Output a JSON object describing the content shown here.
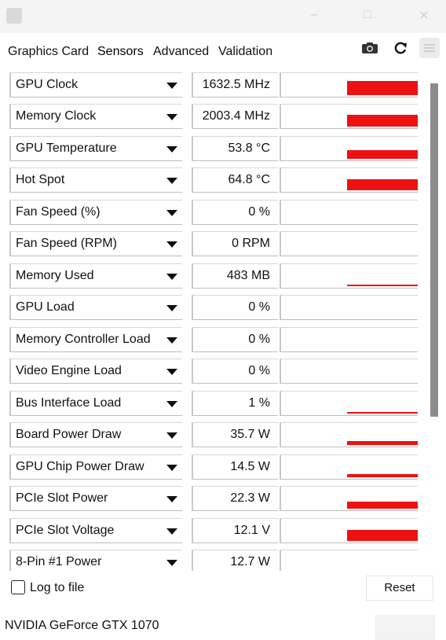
{
  "tabs": [
    {
      "label": "Graphics Card"
    },
    {
      "label": "Sensors",
      "active": true
    },
    {
      "label": "Advanced"
    },
    {
      "label": "Validation"
    }
  ],
  "icons": {
    "camera": "camera-icon",
    "refresh": "refresh-icon",
    "menu": "menu-icon"
  },
  "colors": {
    "graph_bar": "#ee1111",
    "scrollbar_thumb": "#8c8c8c"
  },
  "sensors": [
    {
      "name": "GPU Clock",
      "value": "1632.5 MHz",
      "graph_level": 0.6
    },
    {
      "name": "Memory Clock",
      "value": "2003.4 MHz",
      "graph_level": 0.5
    },
    {
      "name": "GPU Temperature",
      "value": "53.8 °C",
      "graph_level": 0.35
    },
    {
      "name": "Hot Spot",
      "value": "64.8 °C",
      "graph_level": 0.45
    },
    {
      "name": "Fan Speed (%)",
      "value": "0 %",
      "graph_level": 0
    },
    {
      "name": "Fan Speed (RPM)",
      "value": "0 RPM",
      "graph_level": 0
    },
    {
      "name": "Memory Used",
      "value": "483 MB",
      "graph_level": 0.06
    },
    {
      "name": "GPU Load",
      "value": "0 %",
      "graph_level": 0
    },
    {
      "name": "Memory Controller Load",
      "value": "0 %",
      "graph_level": 0
    },
    {
      "name": "Video Engine Load",
      "value": "0 %",
      "graph_level": 0
    },
    {
      "name": "Bus Interface Load",
      "value": "1 %",
      "graph_level": 0.01
    },
    {
      "name": "Board Power Draw",
      "value": "35.7 W",
      "graph_level": 0.18
    },
    {
      "name": "GPU Chip Power Draw",
      "value": "14.5 W",
      "graph_level": 0.12
    },
    {
      "name": "PCIe Slot Power",
      "value": "22.3 W",
      "graph_level": 0.3
    },
    {
      "name": "PCIe Slot Voltage",
      "value": "12.1 V",
      "graph_level": 0.45
    },
    {
      "name": "8-Pin #1 Power",
      "value": "12.7 W",
      "graph_level": 0.05
    }
  ],
  "footer": {
    "log_label": "Log to file",
    "log_checked": false,
    "reset_label": "Reset"
  },
  "gpu_name": "NVIDIA GeForce GTX 1070"
}
